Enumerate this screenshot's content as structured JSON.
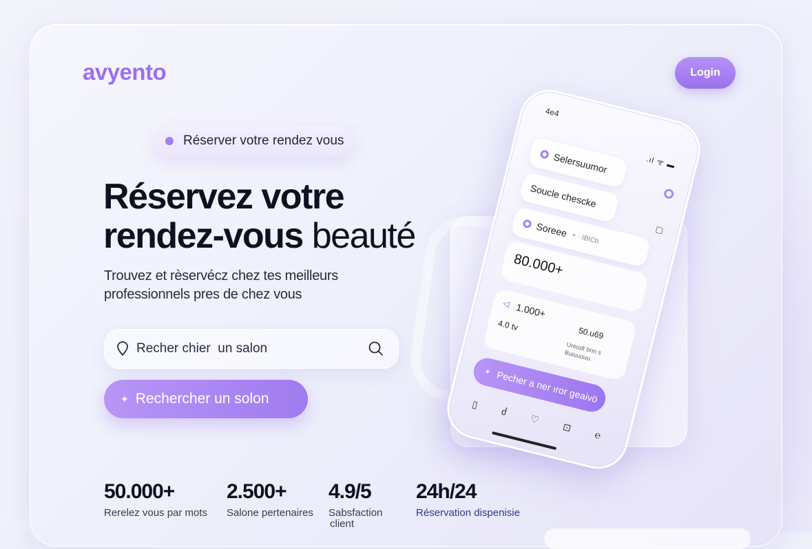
{
  "brand": {
    "logo": "avyento"
  },
  "header": {
    "login_label": "Login"
  },
  "hero": {
    "pill_text": "Réserver votre rendez vous",
    "headline_bold_1": "Réservez votre",
    "headline_bold_2": "rendez-vous",
    "headline_light": " beauté",
    "subtext_line1": "Trouvez et rèservécz chez tes meilleurs",
    "subtext_line2": "professionnels pres de chez vous",
    "search_value": "Recher chier  un salon",
    "cta_label": "Rechercher un solon"
  },
  "stats": [
    {
      "value": "50.000+",
      "label": "Rerelez vous par mots"
    },
    {
      "value": "2.500+",
      "label": "Salone pertenaires"
    },
    {
      "value": "4.9/5",
      "label": "Sabsfaction",
      "label2": "client"
    },
    {
      "value": "24h/24",
      "label": "Réservation dispenisie"
    }
  ],
  "phone": {
    "time": "4e4",
    "status": ".ıl ᯤ ▬",
    "row1": "Selersuumor",
    "row2": "Soucle chescke",
    "row3": "Soreee",
    "row3_extra": "+ · IBICb",
    "big_value": "80.000+",
    "card_a": "1.000+",
    "card_b": "4.0 tv",
    "card_c": "50.u69",
    "card_d": "Ureudt bnn s",
    "card_e": "Buiuuouu.",
    "cta": "Pecher a ner ıror geaivö",
    "accent": "#a57df0"
  },
  "icons": [
    "map-pin-icon",
    "search-icon",
    "sparkle-icon"
  ],
  "colors": {
    "brand": "#9b6ff0",
    "button": "#a07bf0"
  }
}
